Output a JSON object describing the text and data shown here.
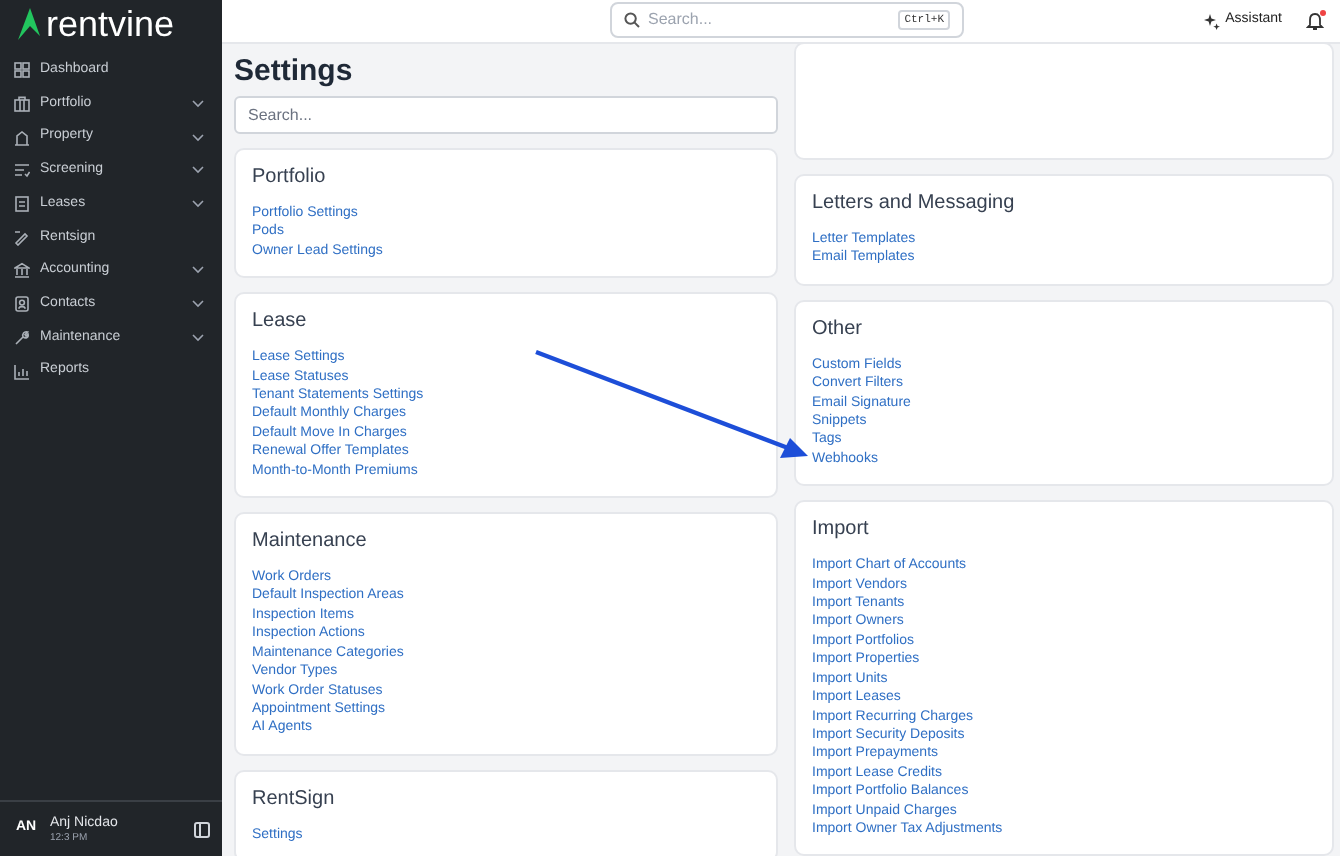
{
  "sidebar": {
    "logo": "rentvine",
    "items": [
      {
        "label": "Dashboard",
        "kind": "link"
      },
      {
        "label": "Portfolio",
        "kind": "group"
      },
      {
        "label": "Property",
        "kind": "group"
      },
      {
        "label": "Screening",
        "kind": "group"
      },
      {
        "label": "Leases",
        "kind": "group"
      },
      {
        "label": "Rentsign",
        "kind": "link"
      },
      {
        "label": "Accounting",
        "kind": "group"
      },
      {
        "label": "Contacts",
        "kind": "group"
      },
      {
        "label": "Maintenance",
        "kind": "group"
      },
      {
        "label": "Reports",
        "kind": "link"
      }
    ],
    "user": {
      "initials": "AN",
      "name": "Anj Nicdao",
      "time": "12:3 PM"
    }
  },
  "header": {
    "search": {
      "placeholder": "Search...",
      "shortcut": "Ctrl+K"
    },
    "assistant": "Assistant",
    "notification_dot": true
  },
  "page": {
    "title": "Settings",
    "search": {
      "placeholder": "Search..."
    }
  },
  "columns": [
    [
      {
        "title": "Portfolio",
        "links": [
          "Portfolio Settings",
          "Pods",
          "Owner Lead Settings"
        ]
      },
      {
        "title": "Lease",
        "links": [
          "Lease Settings",
          "Lease Statuses",
          "Tenant Statements Settings",
          "Default Monthly Charges",
          "Default Move In Charges",
          "Renewal Offer Templates",
          "Month-to-Month Premiums"
        ]
      },
      {
        "title": "Maintenance",
        "links": [
          "Work Orders",
          "Default Inspection Areas",
          "Inspection Items",
          "Inspection Actions",
          "Maintenance Categories",
          "Vendor Types",
          "Work Order Statuses",
          "Appointment Settings",
          "AI Agents"
        ]
      },
      {
        "title": "RentSign",
        "links": [
          "Settings"
        ]
      }
    ],
    [
      {
        "title": "Letters and Messaging",
        "links": [
          "Letter Templates",
          "Email Templates"
        ]
      },
      {
        "title": "Other",
        "links": [
          "Custom Fields",
          "Convert Filters",
          "Email Signature",
          "Snippets",
          "Tags",
          "Webhooks"
        ]
      },
      {
        "title": "Import",
        "links": [
          "Import Chart of Accounts",
          "Import Vendors",
          "Import Tenants",
          "Import Owners",
          "Import Portfolios",
          "Import Properties",
          "Import Units",
          "Import Leases",
          "Import Recurring Charges",
          "Import Security Deposits",
          "Import Prepayments",
          "Import Lease Credits",
          "Import Portfolio Balances",
          "Import Unpaid Charges",
          "Import Owner Tax Adjustments"
        ]
      }
    ]
  ]
}
